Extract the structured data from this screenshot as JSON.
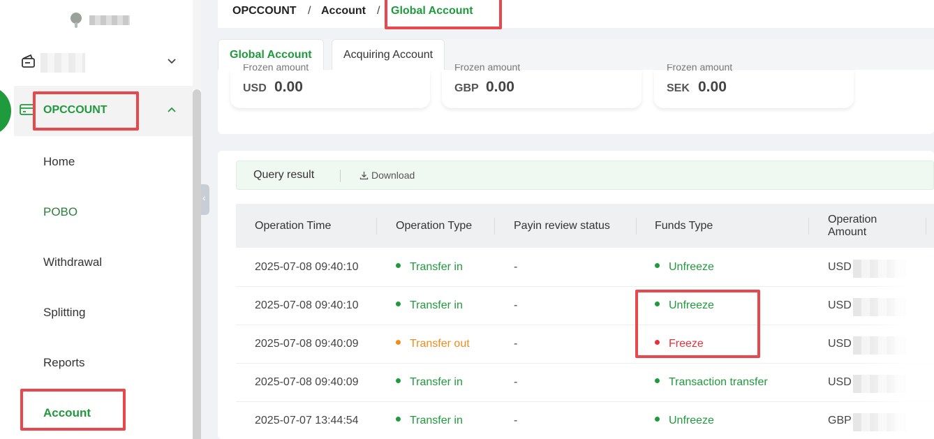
{
  "breadcrumb": {
    "root": "OPCCOUNT",
    "parent": "Account",
    "current": "Global Account",
    "separator": "/"
  },
  "sidebar": {
    "section_label": "OPCCOUNT",
    "items": [
      {
        "label": "Home"
      },
      {
        "label": "POBO"
      },
      {
        "label": "Withdrawal"
      },
      {
        "label": "Splitting"
      },
      {
        "label": "Reports"
      },
      {
        "label": "Account"
      }
    ]
  },
  "tabs": [
    {
      "label": "Global Account"
    },
    {
      "label": "Acquiring Account"
    }
  ],
  "balances": [
    {
      "caption": "Frozen amount",
      "currency": "USD",
      "amount": "0.00"
    },
    {
      "caption": "Frozen amount",
      "currency": "GBP",
      "amount": "0.00"
    },
    {
      "caption": "Frozen amount",
      "currency": "SEK",
      "amount": "0.00"
    }
  ],
  "query": {
    "title": "Query result",
    "download": "Download"
  },
  "table": {
    "headers": {
      "time": "Operation Time",
      "type": "Operation Type",
      "review": "Payin review status",
      "funds": "Funds Type",
      "amount": "Operation Amount"
    },
    "rows": [
      {
        "time": "2025-07-08 09:40:10",
        "type": "Transfer in",
        "review": "-",
        "funds": "Unfreeze",
        "currency": "USD"
      },
      {
        "time": "2025-07-08 09:40:10",
        "type": "Transfer in",
        "review": "-",
        "funds": "Unfreeze",
        "currency": "USD"
      },
      {
        "time": "2025-07-08 09:40:09",
        "type": "Transfer out",
        "review": "-",
        "funds": "Freeze",
        "currency": "USD"
      },
      {
        "time": "2025-07-08 09:40:09",
        "type": "Transfer in",
        "review": "-",
        "funds": "Transaction transfer",
        "currency": "USD"
      },
      {
        "time": "2025-07-07 13:44:54",
        "type": "Transfer in",
        "review": "-",
        "funds": "Unfreeze",
        "currency": "GBP"
      }
    ]
  },
  "colors": {
    "brand_green": "#1f9a3c",
    "warning_orange": "#f08c1a",
    "danger_red": "#e8303a",
    "highlight_box": "#e8474c"
  }
}
